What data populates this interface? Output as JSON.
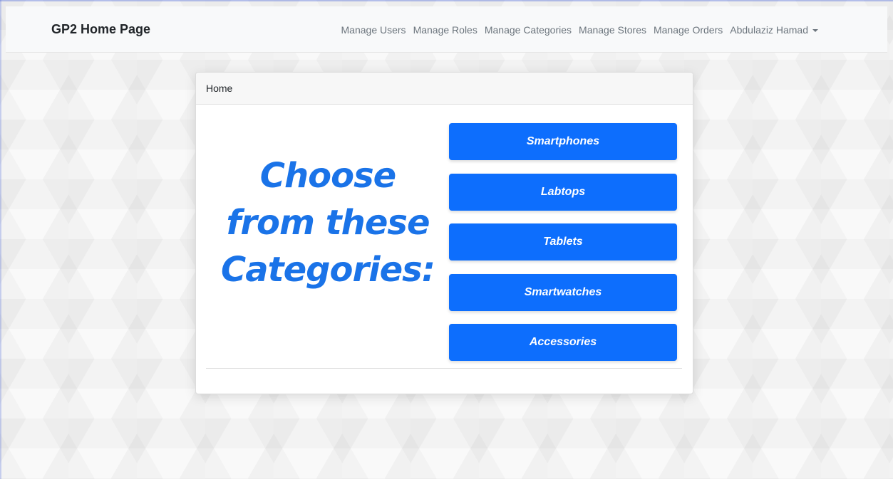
{
  "navbar": {
    "brand": "GP2 Home Page",
    "links": [
      "Manage Users",
      "Manage Roles",
      "Manage Categories",
      "Manage Stores",
      "Manage Orders"
    ],
    "user": "Abdulaziz Hamad"
  },
  "card": {
    "header": "Home",
    "headline_lines": [
      "Choose",
      "from these",
      "Categories:"
    ],
    "categories": [
      "Smartphones",
      "Labtops",
      "Tablets",
      "Smartwatches",
      "Accessories"
    ]
  },
  "colors": {
    "accent": "#0d6efd",
    "headline": "#1a73e8"
  },
  "icons": {
    "user_menu": "caret-down-icon"
  }
}
